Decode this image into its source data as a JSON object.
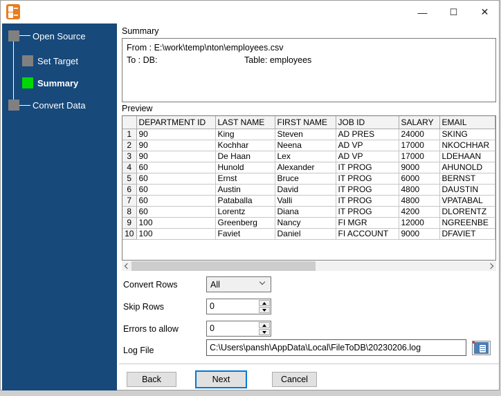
{
  "window": {
    "caption": {
      "minimize": "—",
      "maximize": "☐",
      "close": "✕"
    }
  },
  "sidebar": {
    "steps": [
      {
        "label": "Open Source",
        "active": false
      },
      {
        "label": "Set Target",
        "active": false
      },
      {
        "label": "Summary",
        "active": true
      },
      {
        "label": "Convert Data",
        "active": false
      }
    ]
  },
  "summary": {
    "section_label": "Summary",
    "from_line": "From : E:\\work\\temp\\nton\\employees.csv",
    "to_label": "To : DB:",
    "table_label": "Table: employees"
  },
  "preview": {
    "section_label": "Preview",
    "columns": [
      "DEPARTMENT ID",
      "LAST NAME",
      "FIRST NAME",
      "JOB ID",
      "SALARY",
      "EMAIL"
    ],
    "rows": [
      {
        "n": "1",
        "c": [
          "90",
          "King",
          "Steven",
          "AD PRES",
          "24000",
          "SKING"
        ]
      },
      {
        "n": "2",
        "c": [
          "90",
          "Kochhar",
          "Neena",
          "AD VP",
          "17000",
          "NKOCHHAR"
        ]
      },
      {
        "n": "3",
        "c": [
          "90",
          "De Haan",
          "Lex",
          "AD VP",
          "17000",
          "LDEHAAN"
        ]
      },
      {
        "n": "4",
        "c": [
          "60",
          "Hunold",
          "Alexander",
          "IT PROG",
          "9000",
          "AHUNOLD"
        ]
      },
      {
        "n": "5",
        "c": [
          "60",
          "Ernst",
          "Bruce",
          "IT PROG",
          "6000",
          "BERNST"
        ]
      },
      {
        "n": "6",
        "c": [
          "60",
          "Austin",
          "David",
          "IT PROG",
          "4800",
          "DAUSTIN"
        ]
      },
      {
        "n": "7",
        "c": [
          "60",
          "Pataballa",
          "Valli",
          "IT PROG",
          "4800",
          "VPATABAL"
        ]
      },
      {
        "n": "8",
        "c": [
          "60",
          "Lorentz",
          "Diana",
          "IT PROG",
          "4200",
          "DLORENTZ"
        ]
      },
      {
        "n": "9",
        "c": [
          "100",
          "Greenberg",
          "Nancy",
          "FI MGR",
          "12000",
          "NGREENBE"
        ]
      },
      {
        "n": "10",
        "c": [
          "100",
          "Faviet",
          "Daniel",
          "FI ACCOUNT",
          "9000",
          "DFAVIET"
        ]
      }
    ]
  },
  "controls": {
    "convert_rows_label": "Convert Rows",
    "convert_rows_value": "All",
    "skip_rows_label": "Skip Rows",
    "skip_rows_value": "0",
    "errors_label": "Errors to allow",
    "errors_value": "0",
    "log_file_label": "Log File",
    "log_file_value": "C:\\Users\\pansh\\AppData\\Local\\FileToDB\\20230206.log"
  },
  "actions": {
    "back": "Back",
    "next": "Next",
    "cancel": "Cancel"
  },
  "colors": {
    "sidebar_bg": "#17497b",
    "active_step_green": "#00d800",
    "inactive_step_gray": "#808080",
    "accent_blue": "#0078d7",
    "icon_orange": "#e87d1e"
  }
}
